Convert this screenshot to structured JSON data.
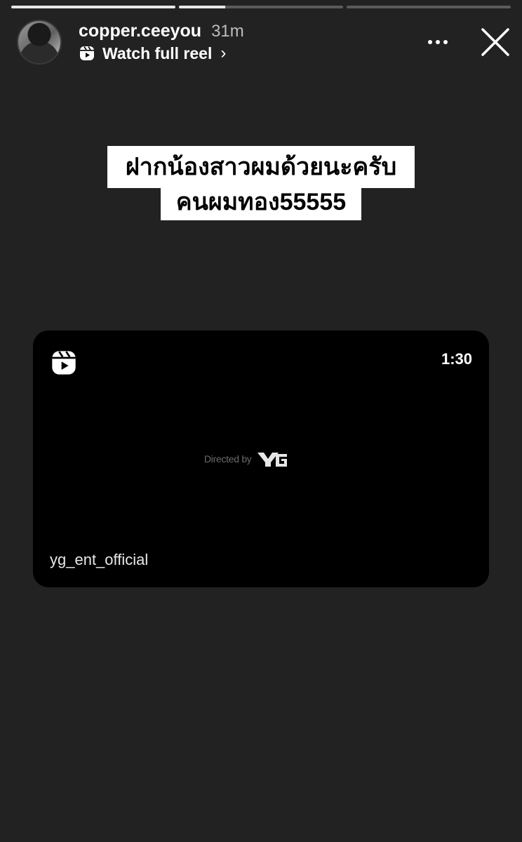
{
  "story": {
    "progress": [
      1.0,
      0.28,
      0.0
    ],
    "username": "copper.ceeyou",
    "time": "31m",
    "watch_label": "Watch full reel",
    "chevron": "›",
    "icons": {
      "reel": "reels-icon",
      "more": "more-horizontal-icon",
      "close": "close-icon"
    }
  },
  "caption": {
    "line1": "ฝากน้องสาวผมด้วยนะครับ",
    "line2": "คนผมทอง55555"
  },
  "reel_card": {
    "duration": "1:30",
    "directed_by": "Directed by",
    "account": "yg_ent_official"
  },
  "colors": {
    "background": "#222222",
    "card": "#000000",
    "caption_bg": "#ffffff",
    "text": "#ffffff"
  }
}
